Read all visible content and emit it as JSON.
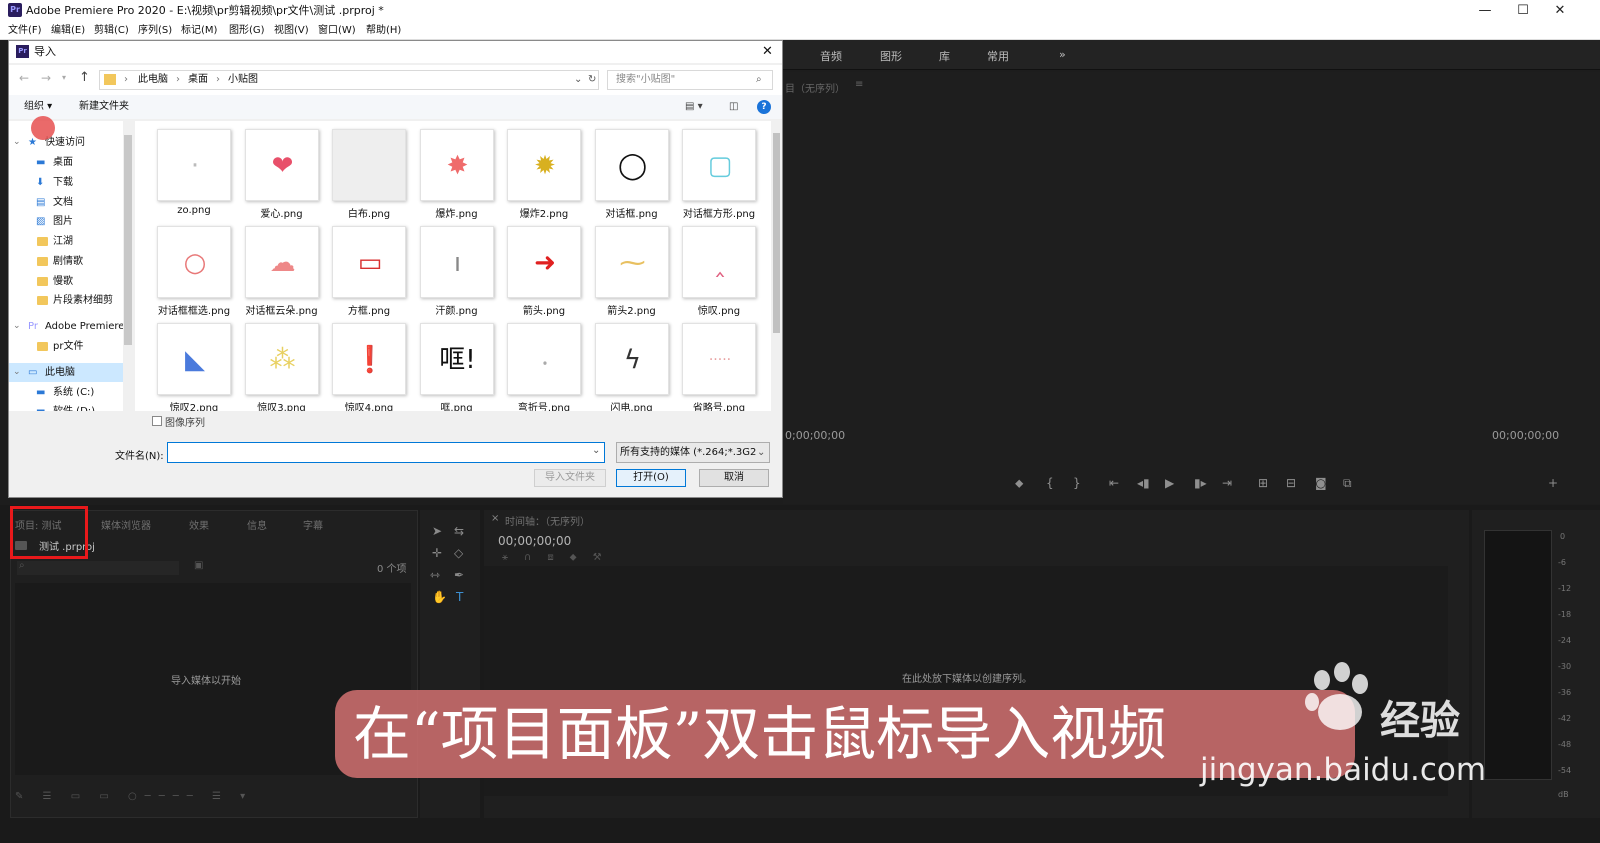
{
  "titlebar": {
    "title": "Adobe Premiere Pro 2020 - E:\\视频\\pr剪辑视频\\pr文件\\测试 .prproj *",
    "minimize": "—",
    "maximize": "☐",
    "close": "✕"
  },
  "menu": [
    "文件(F)",
    "编辑(E)",
    "剪辑(C)",
    "序列(S)",
    "标记(M)",
    "图形(G)",
    "视图(V)",
    "窗口(W)",
    "帮助(H)"
  ],
  "workspace_tabs": [
    "音频",
    "图形",
    "库",
    "常用",
    "»"
  ],
  "program": {
    "label": "目（无序列）",
    "menu": "≡",
    "tc_left": "0;00;00;00",
    "tc_right": "00;00;00;00"
  },
  "dialog": {
    "title": "导入",
    "close": "✕",
    "breadcrumb": [
      "此电脑",
      "桌面",
      "小贴图"
    ],
    "search_placeholder": "搜索\"小贴图\"",
    "organize": "组织 ▾",
    "new_folder": "新建文件夹",
    "help": "?",
    "nav": [
      {
        "label": "快速访问",
        "icon": "star-icon"
      },
      {
        "label": "桌面",
        "icon": "desktop-icon"
      },
      {
        "label": "下载",
        "icon": "download-icon"
      },
      {
        "label": "文档",
        "icon": "document-icon"
      },
      {
        "label": "图片",
        "icon": "picture-icon"
      },
      {
        "label": "江湖",
        "icon": "folder-icon"
      },
      {
        "label": "剧情歌",
        "icon": "folder-icon"
      },
      {
        "label": "慢歌",
        "icon": "folder-icon"
      },
      {
        "label": "片段素材细剪",
        "icon": "folder-icon"
      },
      {
        "label": "Adobe Premiere",
        "icon": "premiere-icon"
      },
      {
        "label": "pr文件",
        "icon": "folder-icon"
      },
      {
        "label": "此电脑",
        "icon": "computer-icon"
      },
      {
        "label": "系统 (C:)",
        "icon": "drive-icon"
      },
      {
        "label": "软件 (D:)",
        "icon": "drive-icon"
      }
    ],
    "files": [
      {
        "name": "zo.png",
        "glyph": "·",
        "color": "#bbbbbb"
      },
      {
        "name": "爱心.png",
        "glyph": "❤",
        "color": "#e8506a"
      },
      {
        "name": "白布.png",
        "glyph": "",
        "color": "#eeeeee"
      },
      {
        "name": "爆炸.png",
        "glyph": "✸",
        "color": "#ef6b6b"
      },
      {
        "name": "爆炸2.png",
        "glyph": "✹",
        "color": "#d8b020"
      },
      {
        "name": "对话框.png",
        "glyph": "◯",
        "color": "#111111"
      },
      {
        "name": "对话框方形.png",
        "glyph": "▢",
        "color": "#66ccdd"
      },
      {
        "name": "对话框框选.png",
        "glyph": "○",
        "color": "#e87878"
      },
      {
        "name": "对话框云朵.png",
        "glyph": "☁",
        "color": "#ee8888"
      },
      {
        "name": "方框.png",
        "glyph": "▭",
        "color": "#d83030"
      },
      {
        "name": "汗颜.png",
        "glyph": "ı",
        "color": "#888888"
      },
      {
        "name": "箭头.png",
        "glyph": "➜",
        "color": "#e02020"
      },
      {
        "name": "箭头2.png",
        "glyph": "⁓",
        "color": "#e8c060"
      },
      {
        "name": "惊叹.png",
        "glyph": "‸",
        "color": "#e06080"
      },
      {
        "name": "惊叹2.png",
        "glyph": "◣",
        "color": "#4a7adc"
      },
      {
        "name": "惊叹3.png",
        "glyph": "⁂",
        "color": "#e8d060"
      },
      {
        "name": "惊叹4.png",
        "glyph": "❗",
        "color": "#d82020"
      },
      {
        "name": "哐.png",
        "glyph": "哐!",
        "color": "#111111"
      },
      {
        "name": "弯折号.png",
        "glyph": "⸳",
        "color": "#aaaaaa"
      },
      {
        "name": "闪电.png",
        "glyph": "ϟ",
        "color": "#333333"
      },
      {
        "name": "省略号.png",
        "glyph": "·····",
        "color": "#e8a0a0"
      }
    ],
    "image_sequence": "图像序列",
    "filename_label": "文件名(N):",
    "filename_value": "",
    "filetype": "所有支持的媒体 (*.264;*.3G2;*",
    "btn_import_folder": "导入文件夹",
    "btn_open": "打开(O)",
    "btn_cancel": "取消"
  },
  "project": {
    "tabs": [
      "项目: 测试",
      "媒体浏览器",
      "效果",
      "信息",
      "字幕"
    ],
    "file": "测试 .prproj",
    "count": "0 个项",
    "empty": "导入媒体以开始"
  },
  "timeline": {
    "tab": "时间轴：（无序列）",
    "timecode": "00;00;00;00",
    "empty": "在此处放下媒体以创建序列。"
  },
  "meter_db": [
    "0",
    "-6",
    "-12",
    "-18",
    "-24",
    "-30",
    "-36",
    "-42",
    "-48",
    "-54",
    "dB"
  ],
  "caption": "在“项目面板”双击鼠标导入视频",
  "watermark": {
    "brand": "经验",
    "url": "jingyan.baidu.com"
  }
}
